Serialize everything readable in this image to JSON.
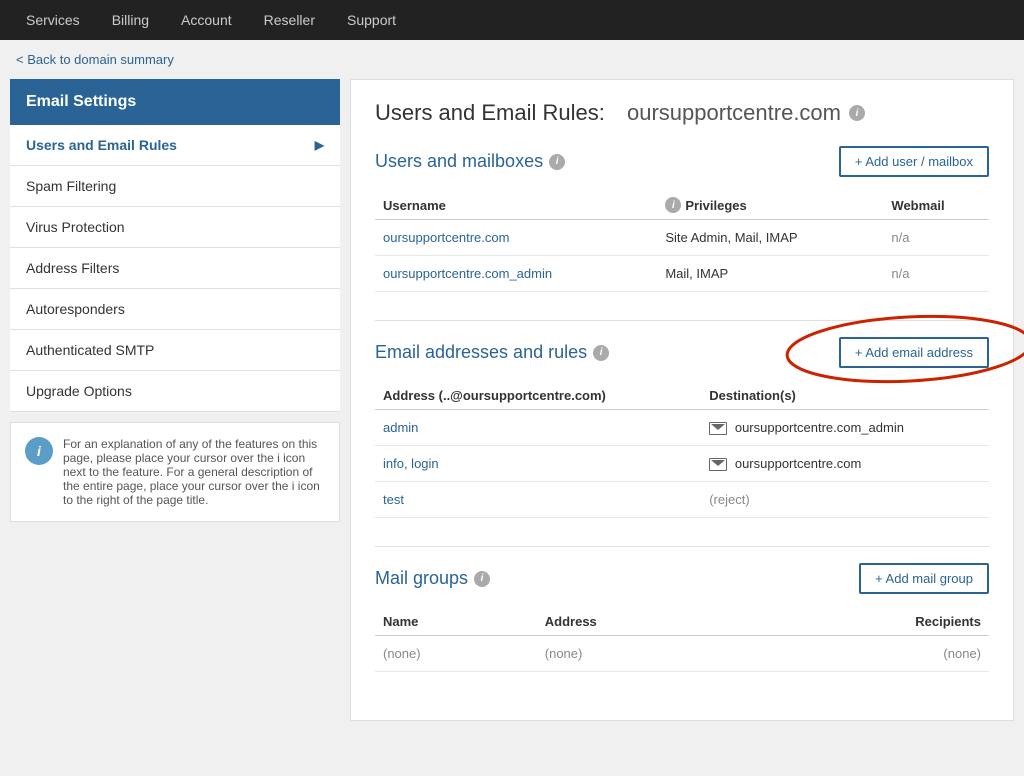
{
  "nav": {
    "items": [
      "Services",
      "Billing",
      "Account",
      "Reseller",
      "Support"
    ]
  },
  "breadcrumb": {
    "text": "< Back to domain summary",
    "link": "#"
  },
  "sidebar": {
    "title": "Email Settings",
    "items": [
      {
        "label": "Users and Email Rules",
        "active": true,
        "arrow": true
      },
      {
        "label": "Spam Filtering",
        "active": false,
        "arrow": false
      },
      {
        "label": "Virus Protection",
        "active": false,
        "arrow": false
      },
      {
        "label": "Address Filters",
        "active": false,
        "arrow": false
      },
      {
        "label": "Autoresponders",
        "active": false,
        "arrow": false
      },
      {
        "label": "Authenticated SMTP",
        "active": false,
        "arrow": false
      },
      {
        "label": "Upgrade Options",
        "active": false,
        "arrow": false
      }
    ],
    "info_text": "For an explanation of any of the features on this page, please place your cursor over the i icon next to the feature. For a general description of the entire page, place your cursor over the i icon to the right of the page title."
  },
  "page": {
    "title": "Users and Email Rules:",
    "domain": "oursupportcentre.com"
  },
  "users_section": {
    "title": "Users and mailboxes",
    "add_button": "+ Add user / mailbox",
    "columns": [
      "Username",
      "Privileges",
      "Webmail"
    ],
    "rows": [
      {
        "username": "oursupportcentre.com",
        "privileges": "Site Admin, Mail, IMAP",
        "webmail": "n/a"
      },
      {
        "username": "oursupportcentre.com_admin",
        "privileges": "Mail, IMAP",
        "webmail": "n/a"
      }
    ]
  },
  "email_section": {
    "title": "Email addresses and rules",
    "add_button": "+ Add email address",
    "columns": [
      "Address (..@oursupportcentre.com)",
      "Destination(s)"
    ],
    "rows": [
      {
        "address": "admin",
        "destination": "oursupportcentre.com_admin",
        "has_icon": true
      },
      {
        "address": "info, login",
        "destination": "oursupportcentre.com",
        "has_icon": true
      },
      {
        "address": "test",
        "destination": "(reject)",
        "has_icon": false
      }
    ]
  },
  "mail_groups_section": {
    "title": "Mail groups",
    "add_button": "+ Add mail group",
    "columns": [
      "Name",
      "Address",
      "Recipients"
    ],
    "rows": [
      {
        "name": "(none)",
        "address": "(none)",
        "recipients": "(none)"
      }
    ]
  }
}
